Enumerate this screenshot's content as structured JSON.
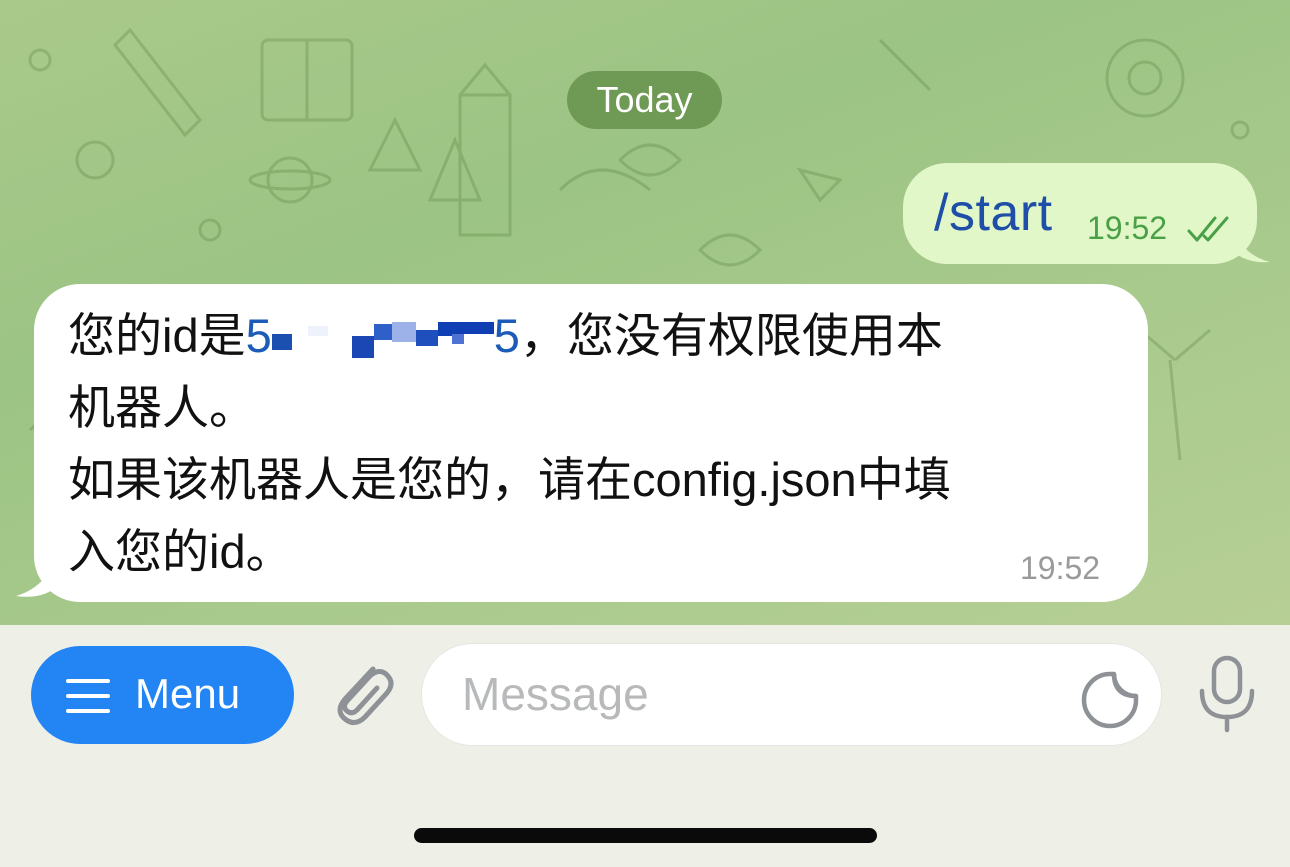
{
  "chat": {
    "date_label": "Today",
    "outgoing": {
      "text": "/start",
      "time": "19:52",
      "status_icon": "double-check-icon",
      "bubble_color": "#e1f7c8",
      "text_color": "#1f4ea8",
      "time_color": "#4aa046"
    },
    "incoming": {
      "line1_prefix": "您的id是",
      "user_id_start": "5",
      "user_id_end": "5",
      "line1_suffix": "，您没有权限使用本",
      "line2": "机器人。",
      "line3": "如果该机器人是您的，请在config.json中填",
      "line4": "入您的id。",
      "time": "19:52",
      "link_color": "#1d5bb8"
    }
  },
  "composer": {
    "menu_label": "Menu",
    "menu_icon": "hamburger-icon",
    "attach_icon": "paperclip-icon",
    "message_placeholder": "Message",
    "sticker_icon": "sticker-icon",
    "mic_icon": "microphone-icon",
    "accent_color": "#2384f4"
  }
}
